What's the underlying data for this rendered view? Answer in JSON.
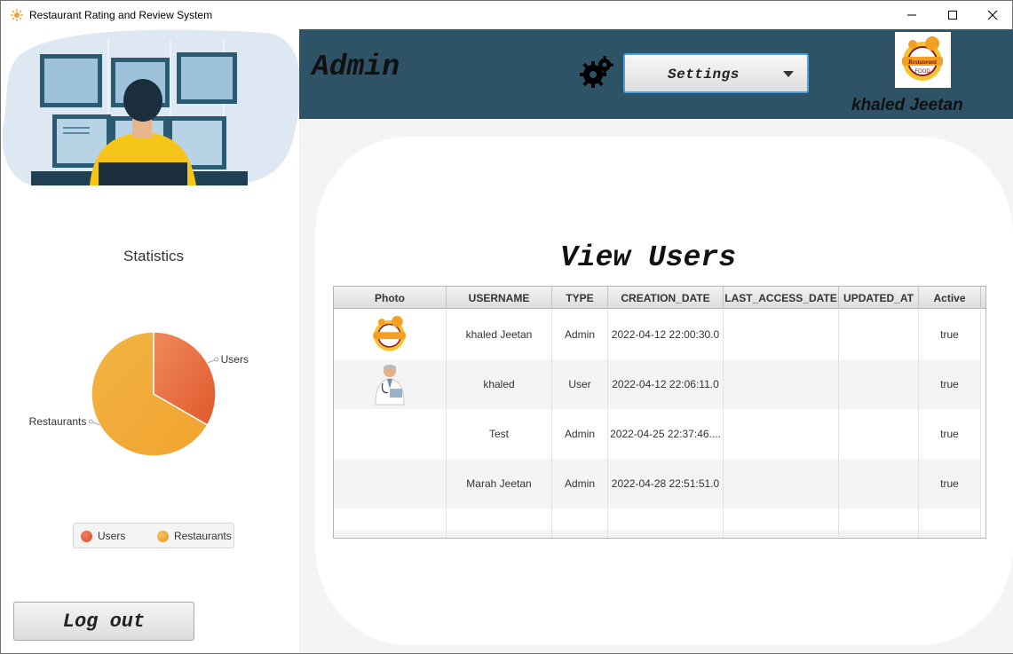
{
  "window": {
    "title": "Restaurant Rating and Review System",
    "controls": {
      "minimize_icon": "minimize-icon",
      "maximize_icon": "maximize-icon",
      "close_icon": "close-icon"
    }
  },
  "sidebar": {
    "statistics_title": "Statistics",
    "logout_label": "Log out"
  },
  "chart_data": {
    "type": "pie",
    "title": "",
    "slices": [
      {
        "label": "Users",
        "value": 4,
        "color": "#e0582b"
      },
      {
        "label": "Restaurants",
        "value": 8,
        "color": "#f0a32e"
      }
    ],
    "legend": [
      "Users",
      "Restaurants"
    ],
    "legend_placement": "bottom"
  },
  "header": {
    "role_title": "Admin",
    "settings_label": "Settings",
    "user_name": "khaled Jeetan",
    "logo_text": "Restaurant FOOD",
    "background": "#2e5266"
  },
  "main": {
    "title": "View Users",
    "table": {
      "columns": [
        "Photo",
        "USERNAME",
        "TYPE",
        "CREATION_DATE",
        "LAST_ACCESS_DATE",
        "UPDATED_AT",
        "Active"
      ],
      "rows": [
        {
          "photo": "restaurant-logo",
          "username": "khaled Jeetan",
          "type": "Admin",
          "creation_date": "2022-04-12 22:00:30.0",
          "last_access_date": "",
          "updated_at": "",
          "active": "true"
        },
        {
          "photo": "doctor-avatar",
          "username": "khaled",
          "type": "User",
          "creation_date": "2022-04-12 22:06:11.0",
          "last_access_date": "",
          "updated_at": "",
          "active": "true"
        },
        {
          "photo": "",
          "username": "Test",
          "type": "Admin",
          "creation_date": "2022-04-25 22:37:46....",
          "last_access_date": "",
          "updated_at": "",
          "active": "true"
        },
        {
          "photo": "",
          "username": "Marah Jeetan",
          "type": "Admin",
          "creation_date": "2022-04-28 22:51:51.0",
          "last_access_date": "",
          "updated_at": "",
          "active": "true"
        }
      ]
    }
  }
}
